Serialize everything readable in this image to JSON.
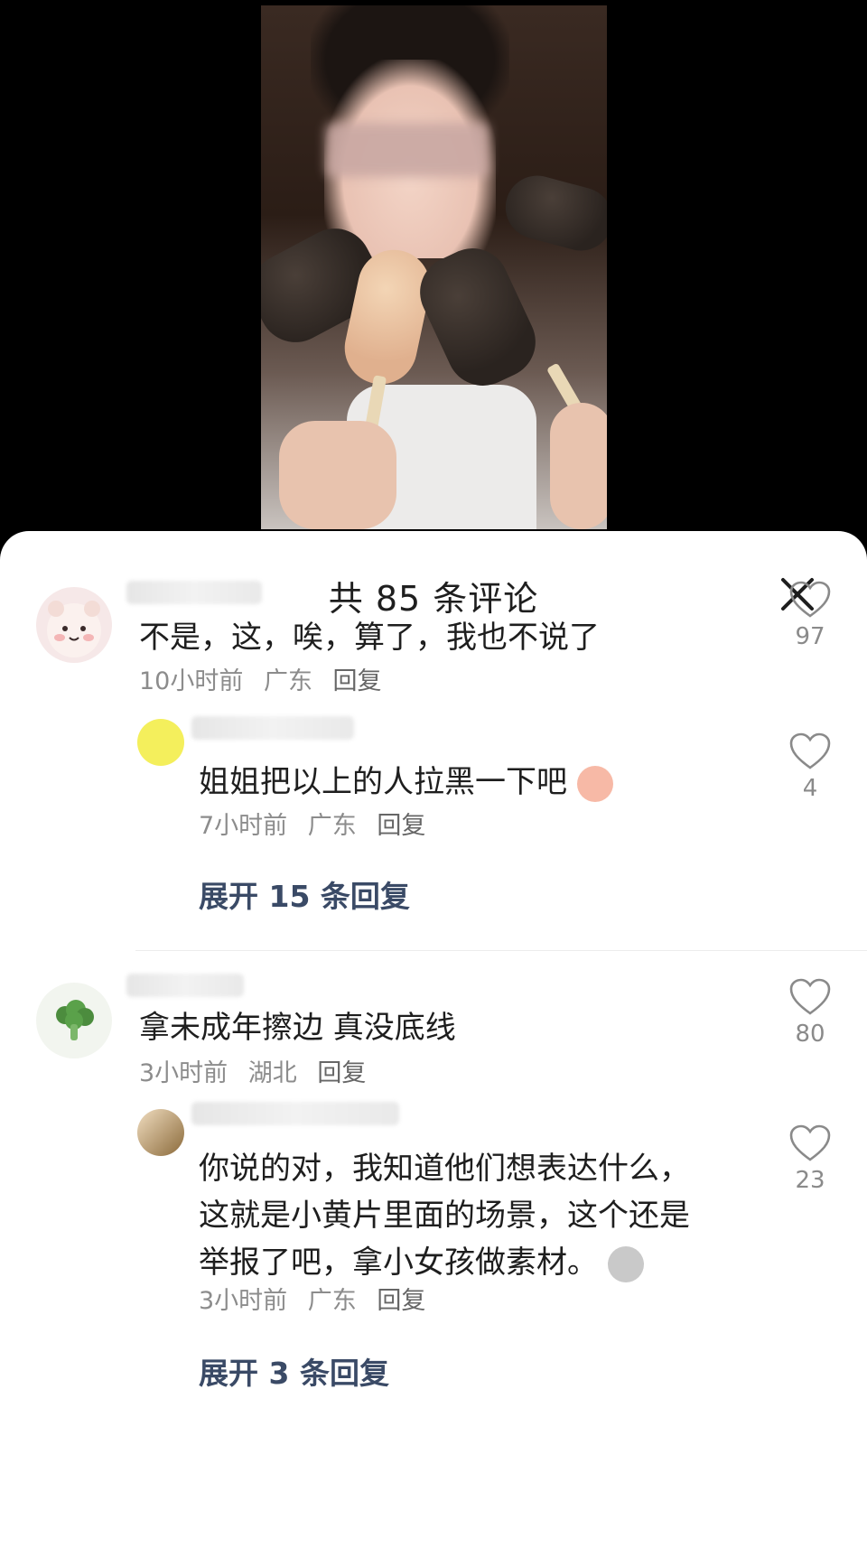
{
  "header": {
    "title": "共 85 条评论",
    "close_icon": "close-icon"
  },
  "comments": [
    {
      "avatar_icon": "bear-avatar-icon",
      "text": "不是，这，唉，算了，我也不说了",
      "time": "10小时前",
      "location": "广东",
      "reply_label": "回复",
      "likes": "97",
      "replies": [
        {
          "avatar_icon": "yellow-dot-avatar",
          "text": "姐姐把以上的人拉黑一下吧",
          "emoji": "peach-emoji-icon",
          "time": "7小时前",
          "location": "广东",
          "reply_label": "回复",
          "likes": "4"
        }
      ],
      "expand_label": "展开 15 条回复"
    },
    {
      "avatar_icon": "broccoli-avatar-icon",
      "text": "拿未成年擦边 真没底线",
      "time": "3小时前",
      "location": "湖北",
      "reply_label": "回复",
      "likes": "80",
      "replies": [
        {
          "avatar_icon": "anime-avatar-icon",
          "text_lines": [
            "你说的对，我知道他们想表达什么，",
            "这就是小黄片里面的场景，这个还是",
            "举报了吧，拿小女孩做素材。"
          ],
          "emoji": "sad-emoji-icon",
          "time": "3小时前",
          "location": "广东",
          "reply_label": "回复",
          "likes": "23"
        }
      ],
      "expand_label": "展开 3 条回复"
    }
  ],
  "colors": {
    "accent_link": "#3a4a66",
    "meta_gray": "#8c8c8c",
    "text": "#1e1e1e"
  }
}
